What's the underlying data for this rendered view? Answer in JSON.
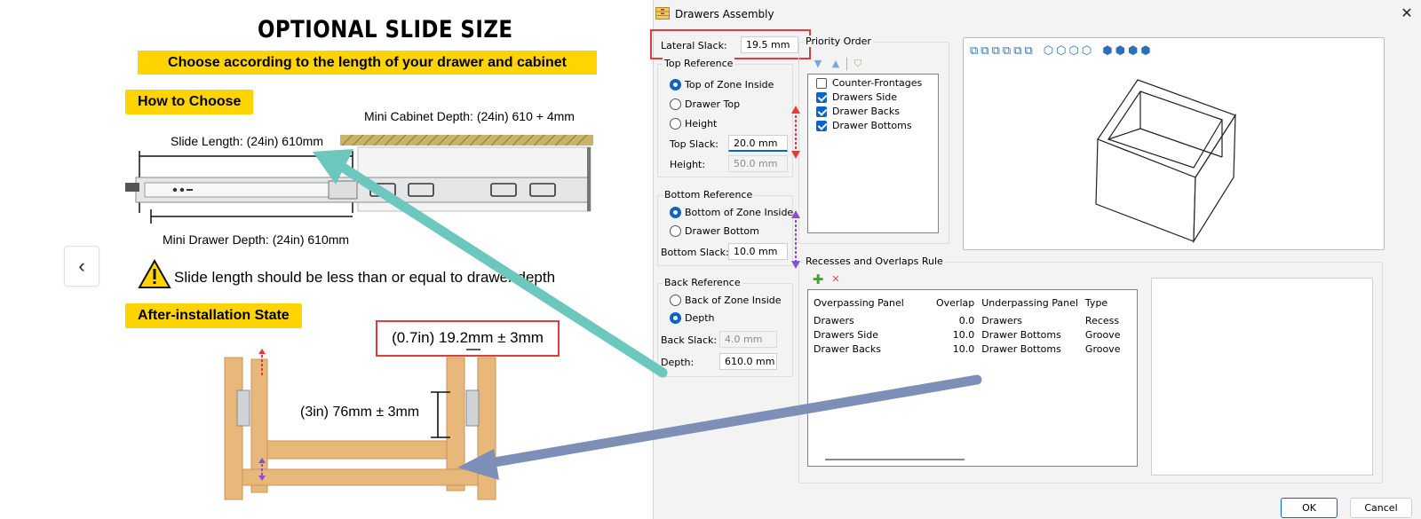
{
  "left_image": {
    "title": "OPTIONAL SLIDE SIZE",
    "banner": "Choose according to the length of your drawer and cabinet",
    "how_to_choose": "How to Choose",
    "mini_cabinet_depth": "Mini Cabinet Depth: (24in) 610 + 4mm",
    "slide_length": "Slide Length: (24in) 610mm",
    "mini_drawer_depth": "Mini Drawer Depth: (24in) 610mm",
    "warning": "Slide length should be less than or equal to drawer depth",
    "after_installation": "After-installation State",
    "gap_label": "(0.7in) 19.2mm ± 3mm",
    "height_label": "(3in) 76mm ± 3mm",
    "prev_arrow": "‹"
  },
  "dialog": {
    "title": "Drawers Assembly",
    "close": "✕",
    "lateral_slack_label": "Lateral Slack:",
    "lateral_slack_value": "19.5 mm",
    "top_reference": {
      "title": "Top Reference",
      "options": [
        "Top of Zone Inside",
        "Drawer Top",
        "Height"
      ],
      "selected": "Top of Zone Inside",
      "top_slack_label": "Top Slack:",
      "top_slack_value": "20.0 mm",
      "height_label": "Height:",
      "height_value": "50.0 mm"
    },
    "bottom_reference": {
      "title": "Bottom Reference",
      "options": [
        "Bottom of Zone Inside",
        "Drawer Bottom"
      ],
      "selected": "Bottom of Zone Inside",
      "bottom_slack_label": "Bottom Slack:",
      "bottom_slack_value": "10.0 mm"
    },
    "back_reference": {
      "title": "Back Reference",
      "options": [
        "Back of Zone Inside",
        "Depth"
      ],
      "selected": "Depth",
      "back_slack_label": "Back Slack:",
      "back_slack_value": "4.0 mm",
      "depth_label": "Depth:",
      "depth_value": "610.0 mm"
    },
    "priority_order": {
      "title": "Priority Order",
      "items": [
        {
          "label": "Counter-Frontages",
          "checked": false
        },
        {
          "label": "Drawers Side",
          "checked": true
        },
        {
          "label": "Drawer Backs",
          "checked": true
        },
        {
          "label": "Drawer Bottoms",
          "checked": true
        }
      ]
    },
    "recesses": {
      "title": "Recesses and Overlaps Rule",
      "columns": [
        "Overpassing Panel",
        "Overlap",
        "Underpassing Panel",
        "Type"
      ],
      "rows": [
        [
          "Drawers",
          "0.0",
          "Drawers",
          "Recess"
        ],
        [
          "Drawers Side",
          "10.0",
          "Drawer Bottoms",
          "Groove"
        ],
        [
          "Drawer Backs",
          "10.0",
          "Drawer Bottoms",
          "Groove"
        ]
      ]
    },
    "ok_label": "OK",
    "cancel_label": "Cancel"
  },
  "colors": {
    "accent": "#0b63c5",
    "highlight_red": "#e23b3b",
    "banner_yellow": "#ffd400",
    "teal_arrow": "#6cc7bd",
    "slate_arrow": "#7e8fb7"
  }
}
